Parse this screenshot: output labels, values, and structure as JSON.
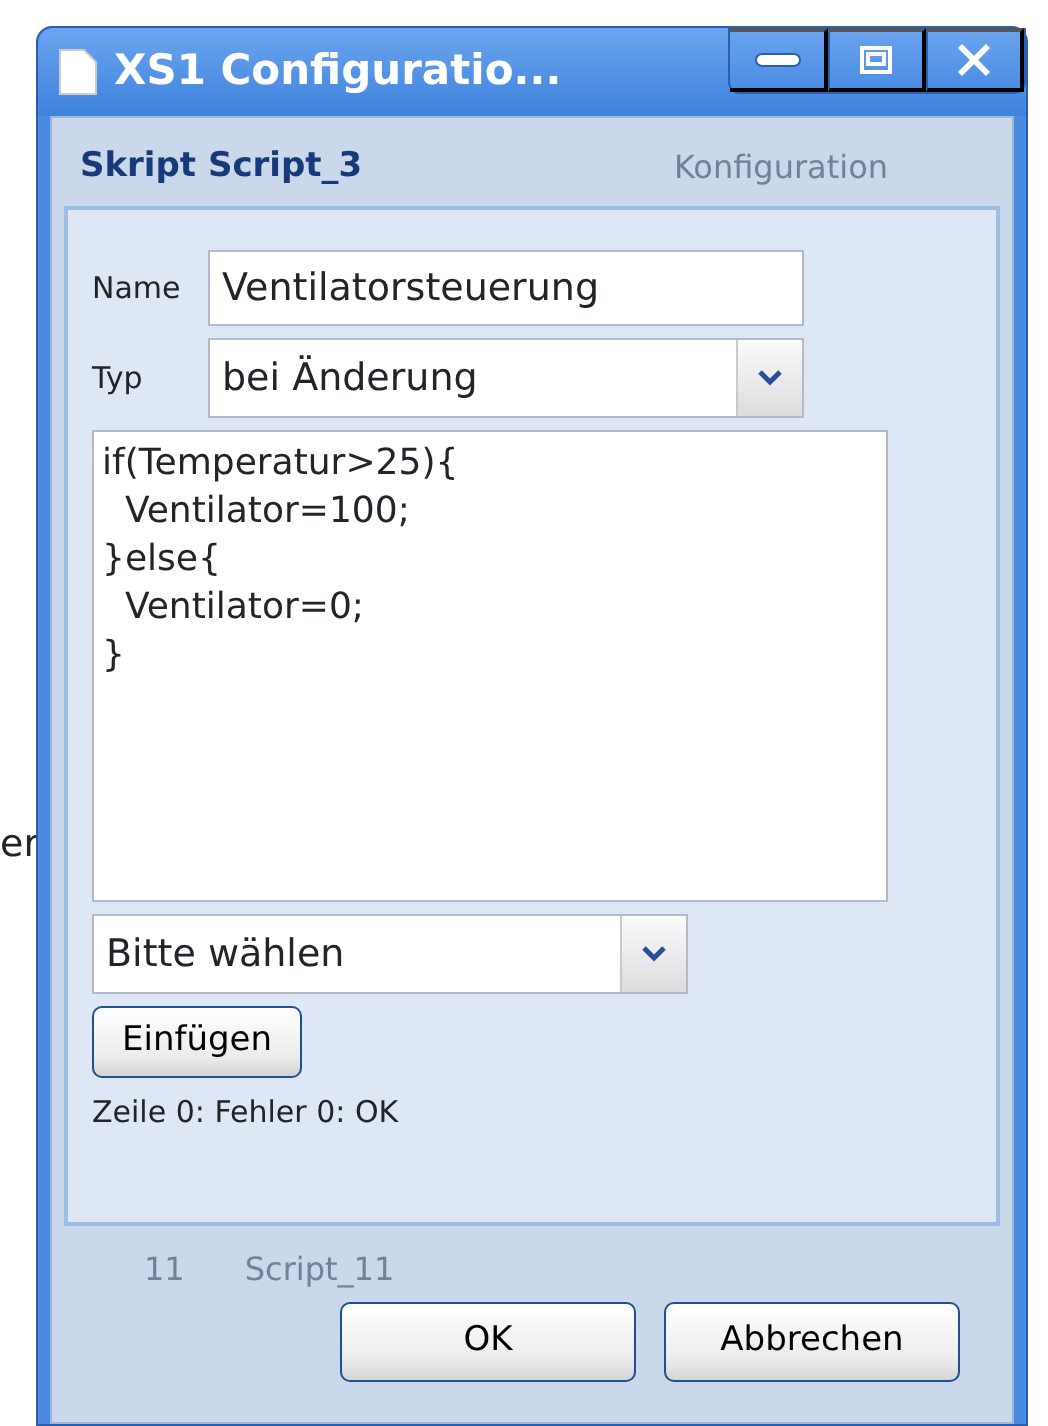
{
  "outside_text": "er",
  "window": {
    "title": "XS1 Configuratio..."
  },
  "background": {
    "tab_label": "Konfiguration",
    "row_number": "11",
    "row_name": "Script_11"
  },
  "panel": {
    "title": "Skript Script_3"
  },
  "form": {
    "name": {
      "label": "Name",
      "value": "Ventilatorsteuerung"
    },
    "type": {
      "label": "Typ",
      "value": "bei Änderung"
    },
    "code": "if(Temperatur>25){\n  Ventilator=100;\n}else{\n  Ventilator=0;\n}",
    "insert_select": {
      "value": "Bitte wählen"
    },
    "insert_button": "Einfügen",
    "status": "Zeile 0: Fehler 0: OK"
  },
  "buttons": [
    "OK",
    "Abbrechen"
  ]
}
